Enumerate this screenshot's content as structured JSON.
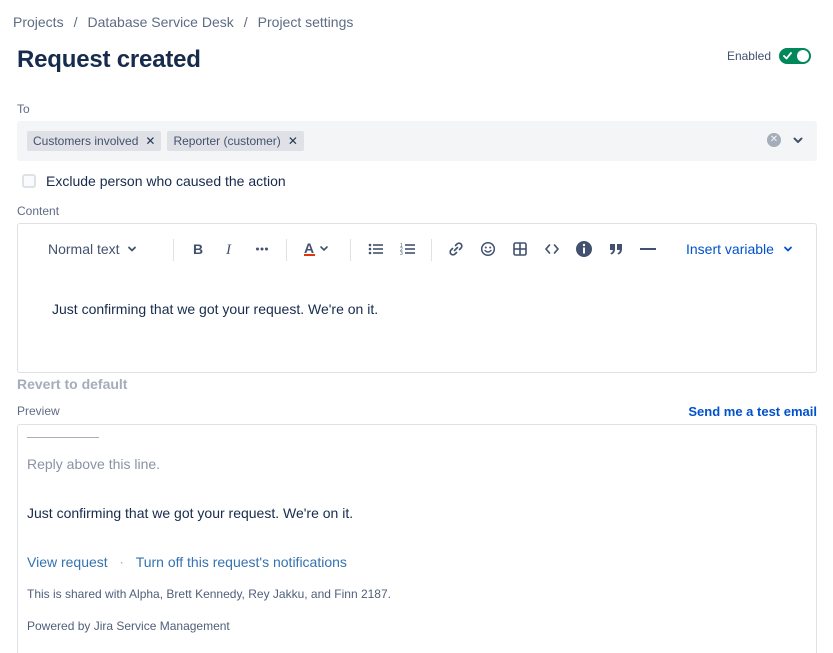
{
  "breadcrumb": {
    "items": [
      "Projects",
      "Database Service Desk",
      "Project settings"
    ],
    "separator": "/"
  },
  "page": {
    "title": "Request created",
    "enabled_label": "Enabled",
    "enabled": true
  },
  "to_field": {
    "label": "To",
    "tags": [
      "Customers involved",
      "Reporter (customer)"
    ]
  },
  "exclude": {
    "label": "Exclude person who caused the action",
    "checked": false
  },
  "content": {
    "label": "Content",
    "toolbar": {
      "text_style": "Normal text",
      "insert_variable": "Insert variable",
      "icons": [
        "bold-icon",
        "italic-icon",
        "more-formatting-icon",
        "text-color-icon",
        "bullet-list-icon",
        "numbered-list-icon",
        "link-icon",
        "emoji-icon",
        "table-icon",
        "code-icon",
        "info-icon",
        "quote-icon",
        "divider-icon"
      ]
    },
    "body": "Just confirming that we got your request. We're on it.",
    "revert_label": "Revert to default"
  },
  "preview": {
    "label": "Preview",
    "send_test_label": "Send me a test email",
    "reply_line": "Reply above this line.",
    "body": "Just confirming that we got your request. We're on it.",
    "view_request": "View request",
    "dot": "·",
    "turn_off": "Turn off this request's notifications",
    "shared": "This is shared with Alpha, Brett Kennedy, Rey Jakku, and Finn 2187.",
    "powered": "Powered by Jira Service Management"
  },
  "colors": {
    "toggle_on": "#00875a",
    "link": "#0052cc",
    "preview_link": "#3572b0"
  }
}
